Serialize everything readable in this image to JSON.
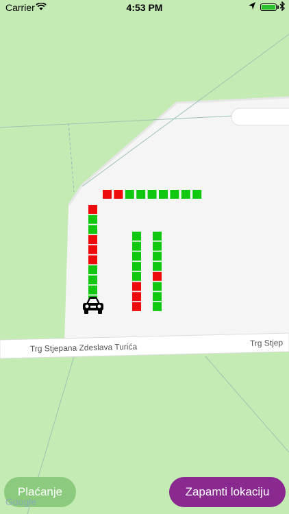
{
  "status_bar": {
    "carrier": "Carrier",
    "time": "4:53 PM",
    "battery_level": 1.0
  },
  "map": {
    "street_name": "Trg Stjepana Zdeslava Turića",
    "street_name_cut": "Trg Stjep",
    "attribution": "Google",
    "colors": {
      "park": "#c3ebb3",
      "plaza": "#f5f5f5",
      "road": "#ffffff",
      "free_spot": "#11c811",
      "taken_spot": "#ee0b0b"
    }
  },
  "parking": {
    "top_row": [
      "taken",
      "taken",
      "free",
      "free",
      "free",
      "free",
      "free",
      "free",
      "free"
    ],
    "left_column": [
      "taken",
      "free",
      "free",
      "taken",
      "taken",
      "taken",
      "free",
      "free",
      "free",
      "free"
    ],
    "middle_column": [
      "free",
      "free",
      "free",
      "free",
      "free",
      "taken",
      "taken",
      "taken"
    ],
    "right_column": [
      "free",
      "free",
      "free",
      "free",
      "taken",
      "free",
      "free",
      "free"
    ]
  },
  "buttons": {
    "pay_label": "Plaćanje",
    "save_location_label": "Zapamti lokaciju"
  },
  "icons": {
    "car": "car-icon",
    "wifi": "wifi-icon",
    "location": "location-arrow-icon",
    "battery": "battery-icon",
    "charging": "bluetooth-icon"
  }
}
